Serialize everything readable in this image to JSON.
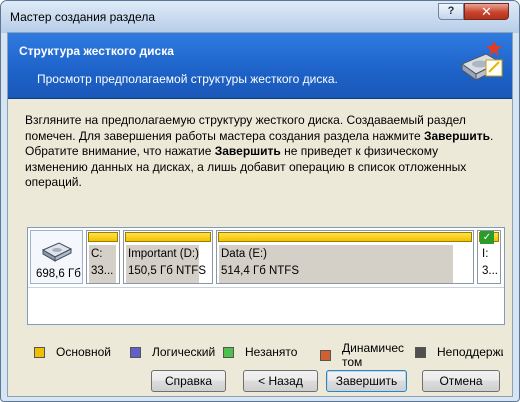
{
  "window": {
    "title": "Мастер создания раздела",
    "help_glyph": "?",
    "close_glyph": "✕"
  },
  "header": {
    "title": "Структура жесткого диска",
    "subtitle": "Просмотр предполагаемой структуры жесткого диска."
  },
  "description": {
    "line1": "Взгляните на предполагаемую структуру жесткого диска. Создаваемый раздел",
    "line2_pre": "помечен. Для завершения работы мастера создания раздела нажмите ",
    "line2_bold": "Завершить",
    "line2_post": ".",
    "line3_pre": "Обратите внимание, что нажатие ",
    "line3_bold": "Завершить",
    "line3_post": " не приведет к физическому",
    "line4": "изменению данных на дисках, а лишь добавит операцию в список отложенных",
    "line5": "операций."
  },
  "disk": {
    "size": "698,6 Гб",
    "partitions": [
      {
        "name": "C:",
        "info": "33...",
        "used_fraction": 0.9
      },
      {
        "name": "Important (D:)",
        "info": "150,5 Гб  NTFS",
        "used_fraction": 0.85
      },
      {
        "name": "Data (E:)",
        "info": "514,4 Гб  NTFS",
        "used_fraction": 0.92
      },
      {
        "name": "I:",
        "info": "3...",
        "used_fraction": 0.3,
        "selected": true,
        "check": "✓"
      }
    ]
  },
  "legend": [
    {
      "label": "Основной",
      "color": "#f0c000"
    },
    {
      "label": "Логический",
      "color": "#6060c8"
    },
    {
      "label": "Незанято",
      "color": "#4ec04e"
    },
    {
      "label": "Динамический том",
      "label_line1": "Динамичес",
      "label_line2": "том",
      "color": "#d06030"
    },
    {
      "label": "Неподдерживаемый",
      "color": "#505050"
    }
  ],
  "buttons": {
    "help": "Справка",
    "back": "< Назад",
    "finish": "Завершить",
    "cancel": "Отмена"
  }
}
